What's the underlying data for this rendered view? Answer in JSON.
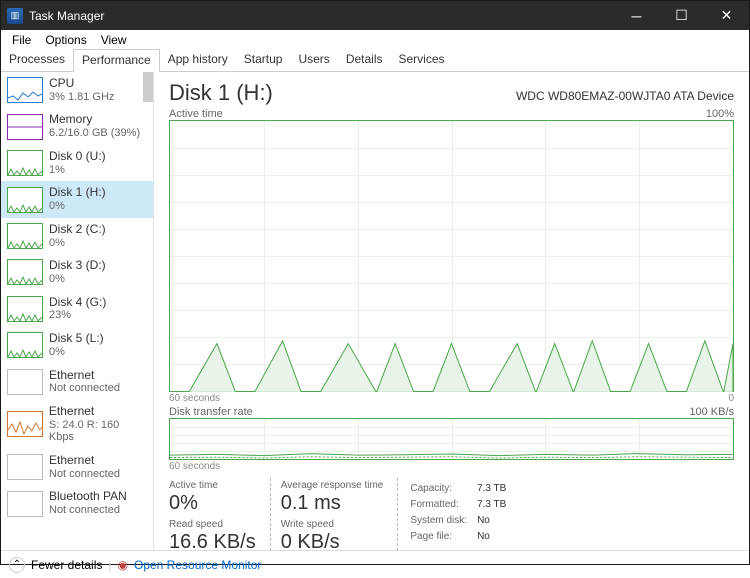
{
  "window": {
    "title": "Task Manager"
  },
  "menu": [
    "File",
    "Options",
    "View"
  ],
  "tabs": [
    "Processes",
    "Performance",
    "App history",
    "Startup",
    "Users",
    "Details",
    "Services"
  ],
  "active_tab": 1,
  "sidebar": [
    {
      "name": "CPU",
      "val": "3% 1.81 GHz",
      "color": "#2a7ad2"
    },
    {
      "name": "Memory",
      "val": "6.2/16.0 GB (39%)",
      "color": "#8b2ab0"
    },
    {
      "name": "Disk 0 (U:)",
      "val": "1%",
      "color": "#4ca64c"
    },
    {
      "name": "Disk 1 (H:)",
      "val": "0%",
      "color": "#4ca64c",
      "sel": true
    },
    {
      "name": "Disk 2 (C:)",
      "val": "0%",
      "color": "#4ca64c"
    },
    {
      "name": "Disk 3 (D:)",
      "val": "0%",
      "color": "#4ca64c"
    },
    {
      "name": "Disk 4 (G:)",
      "val": "23%",
      "color": "#4ca64c"
    },
    {
      "name": "Disk 5 (L:)",
      "val": "0%",
      "color": "#4ca64c"
    },
    {
      "name": "Ethernet",
      "val": "Not connected",
      "color": "#aaa"
    },
    {
      "name": "Ethernet",
      "val": "S: 24.0 R: 160 Kbps",
      "color": "#d07830"
    },
    {
      "name": "Ethernet",
      "val": "Not connected",
      "color": "#aaa"
    },
    {
      "name": "Bluetooth PAN",
      "val": "Not connected",
      "color": "#aaa"
    }
  ],
  "main": {
    "title": "Disk 1 (H:)",
    "device": "WDC WD80EMAZ-00WJTA0 ATA Device",
    "g1": {
      "label": "Active time",
      "max": "100%",
      "xl": "60 seconds",
      "xr": "0"
    },
    "g2": {
      "label": "Disk transfer rate",
      "max": "100 KB/s",
      "xl": "60 seconds"
    },
    "stats": {
      "active_time": {
        "lbl": "Active time",
        "val": "0%"
      },
      "avg_resp": {
        "lbl": "Average response time",
        "val": "0.1 ms"
      },
      "read": {
        "lbl": "Read speed",
        "val": "16.6 KB/s"
      },
      "write": {
        "lbl": "Write speed",
        "val": "0 KB/s"
      }
    },
    "kv": [
      [
        "Capacity:",
        "7.3 TB"
      ],
      [
        "Formatted:",
        "7.3 TB"
      ],
      [
        "System disk:",
        "No"
      ],
      [
        "Page file:",
        "No"
      ]
    ]
  },
  "footer": {
    "fewer": "Fewer details",
    "orm": "Open Resource Monitor"
  },
  "chart_data": [
    {
      "type": "area",
      "title": "Active time",
      "ylabel": "%",
      "ylim": [
        0,
        100
      ],
      "xlabel": "seconds",
      "xlim": [
        60,
        0
      ],
      "x": [
        60,
        58,
        55,
        53,
        51,
        48,
        46,
        44,
        41,
        38,
        36,
        34,
        32,
        30,
        28,
        26,
        23,
        21,
        19,
        17,
        15,
        13,
        11,
        9,
        7,
        5,
        3,
        1,
        0
      ],
      "values": [
        0,
        0,
        18,
        0,
        0,
        19,
        0,
        0,
        18,
        0,
        18,
        0,
        0,
        18,
        0,
        0,
        18,
        0,
        18,
        0,
        19,
        0,
        0,
        18,
        0,
        0,
        19,
        0,
        18
      ]
    },
    {
      "type": "line",
      "title": "Disk transfer rate",
      "ylabel": "KB/s",
      "ylim": [
        0,
        100
      ],
      "xlabel": "seconds",
      "xlim": [
        60,
        0
      ],
      "series": [
        {
          "name": "Read",
          "x": [
            60,
            55,
            50,
            45,
            40,
            35,
            30,
            25,
            20,
            15,
            10,
            5,
            0
          ],
          "values": [
            10,
            12,
            9,
            14,
            10,
            11,
            13,
            9,
            12,
            10,
            14,
            11,
            12
          ]
        },
        {
          "name": "Write",
          "x": [
            60,
            55,
            50,
            45,
            40,
            35,
            30,
            25,
            20,
            15,
            10,
            5,
            0
          ],
          "values": [
            4,
            5,
            3,
            6,
            4,
            5,
            6,
            3,
            5,
            4,
            6,
            5,
            4
          ]
        }
      ]
    }
  ]
}
